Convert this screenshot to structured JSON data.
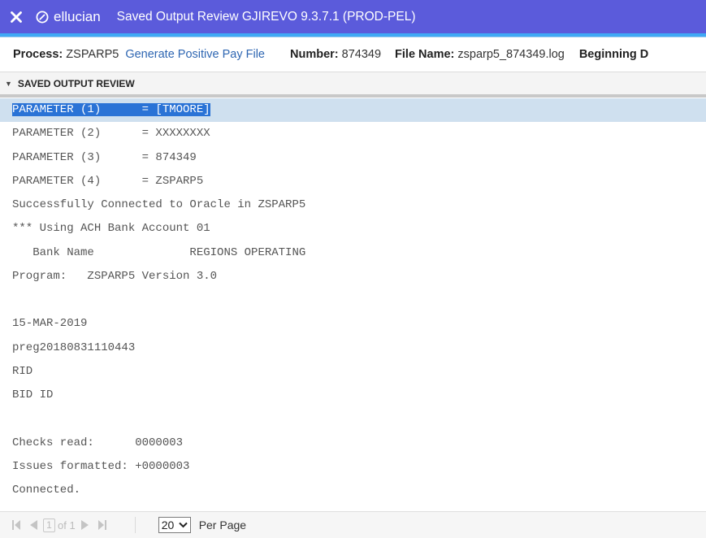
{
  "titlebar": {
    "close_icon": "close-icon",
    "brand": "ellucian",
    "title": "Saved Output Review GJIREVO 9.3.7.1 (PROD-PEL)"
  },
  "info": {
    "process_label": "Process:",
    "process_value": "ZSPARP5",
    "process_desc": "Generate Positive Pay File",
    "number_label": "Number:",
    "number_value": "874349",
    "filename_label": "File Name:",
    "filename_value": "zsparp5_874349.log",
    "beginning_label": "Beginning D"
  },
  "section": {
    "title": "SAVED OUTPUT REVIEW"
  },
  "log": {
    "selected_index": 0,
    "lines": [
      "PARAMETER (1)      = [TMOORE]",
      "PARAMETER (2)      = XXXXXXXX",
      "PARAMETER (3)      = 874349",
      "PARAMETER (4)      = ZSPARP5",
      "Successfully Connected to Oracle in ZSPARP5",
      "*** Using ACH Bank Account 01",
      "   Bank Name              REGIONS OPERATING",
      "Program:   ZSPARP5 Version 3.0",
      "",
      "15-MAR-2019",
      "preg20180831110443",
      "RID",
      "BID ID",
      "",
      "Checks read:      0000003",
      "Issues formatted: +0000003",
      "Connected."
    ]
  },
  "pager": {
    "current_page": "1",
    "of_label": "of 1",
    "per_page_value": "20",
    "per_page_label": "Per Page"
  }
}
